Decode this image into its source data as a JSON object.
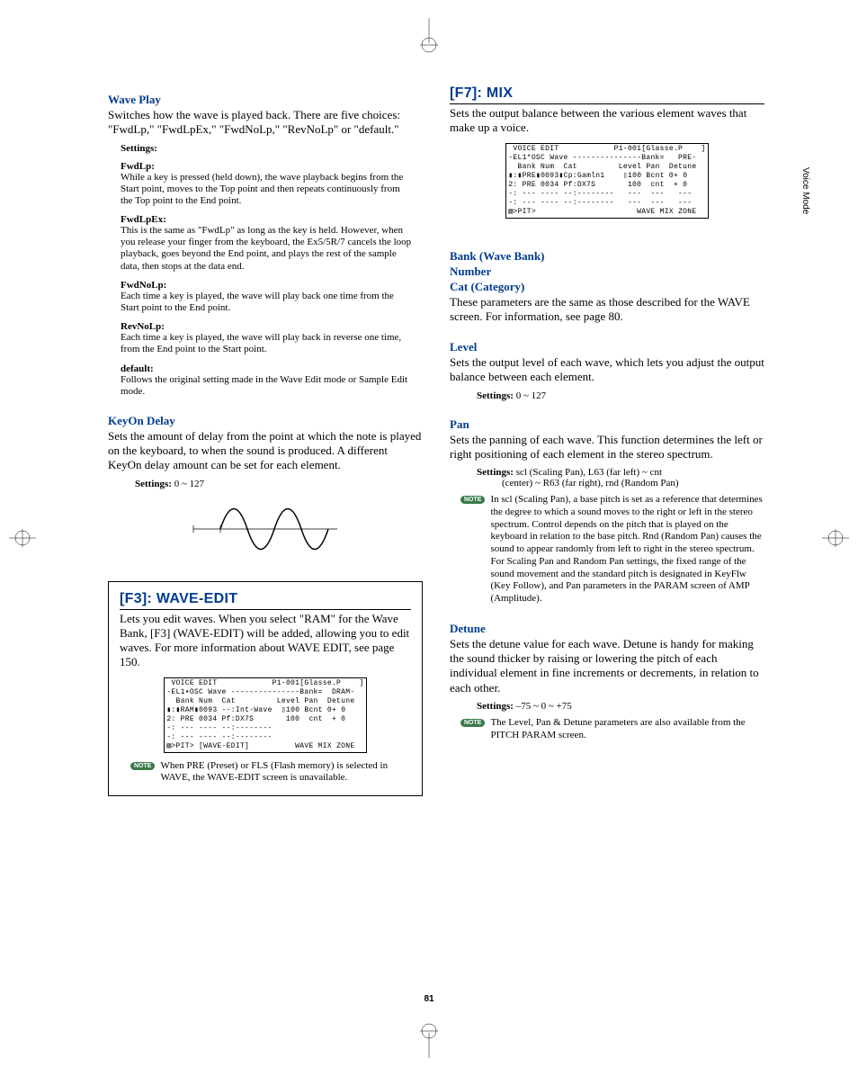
{
  "sideTab": "Voice Mode",
  "pageNumber": "81",
  "left": {
    "wavePlay": {
      "title": "Wave Play",
      "body": "Switches how the wave is played back. There are five choices: \"FwdLp,\" \"FwdLpEx,\" \"FwdNoLp,\" \"RevNoLp\" or \"default.\"",
      "settingsLabel": "Settings:",
      "fwdLp": {
        "title": "FwdLp:",
        "body": "While a key is pressed (held down), the wave playback begins from the Start point, moves to the Top point and then repeats continuously from the Top point to the End point."
      },
      "fwdLpEx": {
        "title": "FwdLpEx:",
        "body": "This is the same as \"FwdLp\" as long as the key is held. However, when you release your finger from the keyboard, the Ex5/5R/7 cancels the loop playback, goes beyond the End point, and plays the rest of the sample data, then stops at the data end."
      },
      "fwdNoLp": {
        "title": "FwdNoLp:",
        "body": "Each time a key is played, the wave will play back one time from the Start point to the End point."
      },
      "revNoLp": {
        "title": "RevNoLp:",
        "body": "Each time a key is played, the wave will play back in reverse one time, from the End point to the Start point."
      },
      "defaultItem": {
        "title": "default:",
        "body": "Follows the original setting made in the Wave Edit mode or Sample Edit mode."
      }
    },
    "keyOn": {
      "title": "KeyOn Delay",
      "body": "Sets the amount of delay from the point at which the note is played on the keyboard, to when the sound is produced. A different KeyOn delay amount can be set for each element.",
      "settingsLabel": "Settings:",
      "settingsValue": "0 ~ 127"
    },
    "f3": {
      "title": "[F3]: WAVE-EDIT",
      "body": "Lets you edit waves. When you select \"RAM\" for the Wave Bank, [F3] (WAVE-EDIT) will be added, allowing you to edit waves. For more information about WAVE EDIT, see page 150.",
      "lcd": " VOICE EDIT            P1-001[Glasse.P    ]\n-EL1▪OSC Wave ---------------Bank=  DRAM-\n  Bank Num  Cat         Level Pan  Detune\n▮:▮RAM▮0093 --:Int-Wave  ▯100 Bcnt 0+ 0\n2: PRE 0034 Pf:DX7S       100  cnt  + 0\n-: --- ---- --:--------\n-: --- ---- --:--------\n▧>PIT> [WAVE-EDIT]          WAVE MIX ZONE",
      "note": "When PRE (Preset) or FLS (Flash memory) is selected in WAVE, the WAVE-EDIT screen is unavailable."
    }
  },
  "right": {
    "f7": {
      "title": "[F7]: MIX",
      "body": "Sets the output balance between the various element waves that make up a voice.",
      "lcd": " VOICE EDIT            P1-001[Glasse.P    ]\n-EL1*OSC Wave ---------------Bank=   PRE-\n  Bank Num  Cat         Level Pan  Detune\n▮:▮PRE▮0093▮Cp:Gamln1    ▯100 Bcnt 0+ 0\n2: PRE 0034 Pf:DX7S       100  cnt  + 0\n-: --- ---- --:--------   ---  ---   ---\n-: --- ---- --:--------   ---  ---   ---\n▧>PIT>                      WAVE MIX ZONE"
    },
    "bankNumCat": {
      "bank": "Bank (Wave Bank)",
      "number": "Number",
      "cat": "Cat (Category)",
      "body": "These parameters are the same as those described for the WAVE screen. For information, see page 80."
    },
    "level": {
      "title": "Level",
      "body": "Sets the output level of each wave, which lets you adjust the output balance between each element.",
      "settingsLabel": "Settings:",
      "settingsValue": "0 ~ 127"
    },
    "pan": {
      "title": "Pan",
      "body": "Sets the panning of each wave. This function determines the left or right positioning of each element in the stereo spectrum.",
      "settingsLabel": "Settings:",
      "settingsValue": "scl (Scaling Pan), L63 (far left) ~ cnt",
      "settingsValue2": "(center) ~ R63 (far right), rnd (Random Pan)",
      "note": "In scl (Scaling Pan), a base pitch is set as a reference that determines the degree to which a sound moves to the right or left in the stereo spectrum. Control depends on the pitch that is played on the keyboard in relation to the base pitch. Rnd (Random Pan) causes the sound to appear randomly from left to right in the stereo spectrum. For Scaling Pan and Random Pan settings, the fixed range of the sound movement and the standard pitch is designated in KeyFlw (Key Follow), and Pan parameters in the PARAM screen of AMP (Amplitude)."
    },
    "detune": {
      "title": "Detune",
      "body": "Sets the detune value for each wave. Detune is handy for making the sound thicker by raising or lowering the pitch of each individual element in fine increments or decrements, in relation to each other.",
      "settingsLabel": "Settings:",
      "settingsValue": "–75 ~ 0 ~ +75",
      "note": "The Level, Pan & Detune parameters are also available from the PITCH PARAM screen."
    }
  },
  "noteBadge": "NOTE"
}
